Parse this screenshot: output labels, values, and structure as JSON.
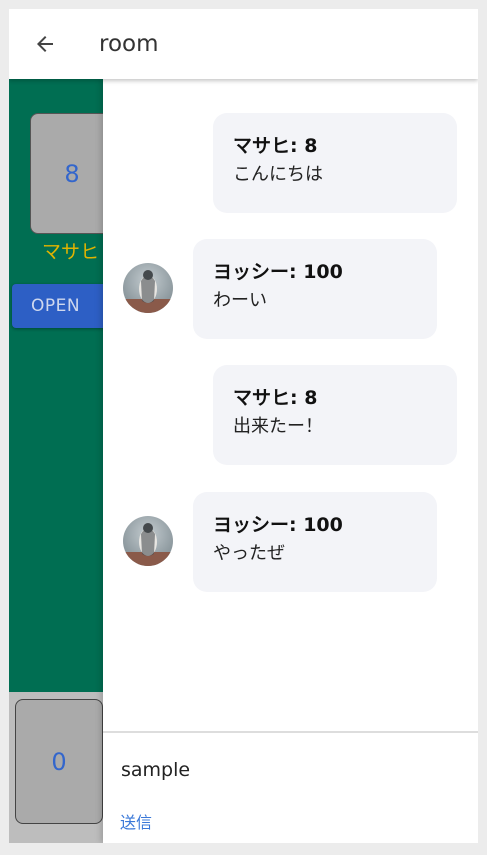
{
  "appbar": {
    "title": "room",
    "back_icon": "arrow-left-icon"
  },
  "game": {
    "top_card_value": "8",
    "top_player_name": "マサヒ",
    "open_button_label": "OPEN",
    "bottom_card_value": "0",
    "colors": {
      "table": "#006e52",
      "card": "#aaaaaa",
      "card_text": "#3366cc",
      "name": "#e0b300",
      "open_button": "#2d5fc5"
    }
  },
  "chat": {
    "messages": [
      {
        "sender": "マサヒ: 8",
        "text": "こんにちは",
        "side": "right",
        "avatar": ""
      },
      {
        "sender": "ヨッシー: 100",
        "text": "わーい",
        "side": "left",
        "avatar": "penguin-avatar"
      },
      {
        "sender": "マサヒ: 8",
        "text": "出来たー！",
        "side": "right",
        "avatar": ""
      },
      {
        "sender": "ヨッシー: 100",
        "text": "やったぜ",
        "side": "left",
        "avatar": "penguin-avatar"
      }
    ],
    "input_value": "sample",
    "send_label": "送信",
    "colors": {
      "bubble": "#f3f4f8",
      "send": "#3a78d8"
    }
  }
}
